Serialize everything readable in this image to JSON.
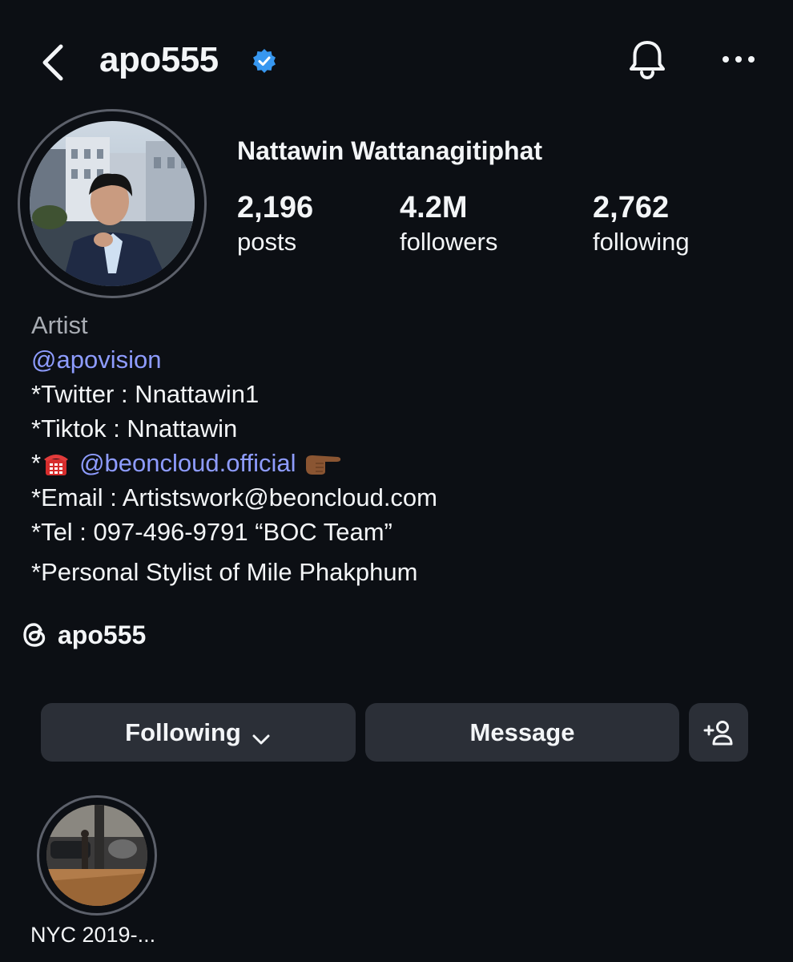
{
  "header": {
    "username": "apo555",
    "icons": [
      "back-arrow-icon",
      "verified-badge-icon",
      "bell-icon",
      "more-icon"
    ],
    "accent_color": "#3797f0"
  },
  "profile": {
    "full_name": "Nattawin Wattanagitiphat",
    "stats": [
      {
        "value": "2,196",
        "label": "posts"
      },
      {
        "value": "4.2M",
        "label": "followers"
      },
      {
        "value": "2,762",
        "label": "following"
      }
    ]
  },
  "bio": {
    "category": "Artist",
    "mention": "@apovision",
    "line_twitter": "*Twitter : Nnattawin1",
    "line_tiktok": "*Tiktok : Nnattawin",
    "line_contact_prefix": "*",
    "line_contact_link": "@beoncloud.official",
    "line_email": "*Email : Artistswork@beoncloud.com",
    "line_tel": "*Tel : 097-496-9791 “BOC Team”",
    "line_stylist": "*Personal Stylist of Mile Phakphum",
    "link_color": "#8e9cff"
  },
  "threads": {
    "label": "apo555",
    "icon": "threads-icon"
  },
  "actions": {
    "following_label": "Following",
    "message_label": "Message",
    "add_user_icon": "add-person-icon"
  },
  "highlights": [
    {
      "label": "NYC 2019-..."
    }
  ]
}
